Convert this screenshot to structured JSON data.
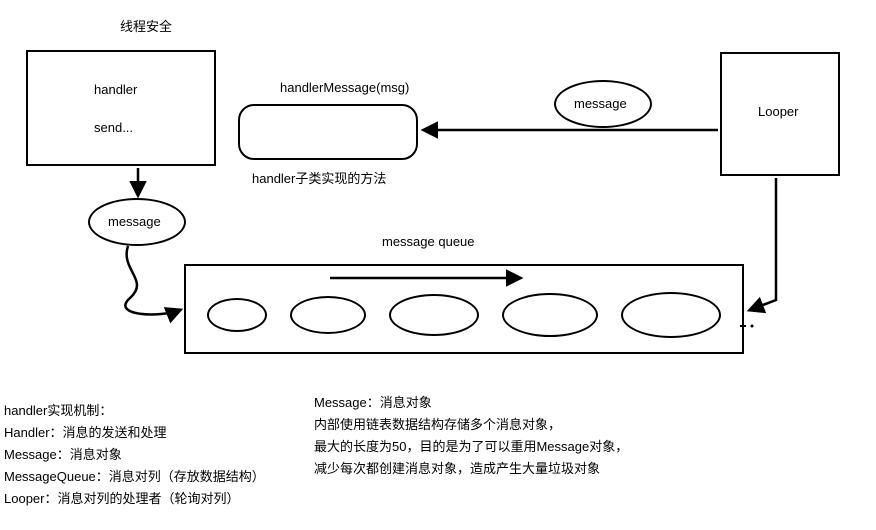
{
  "title": "线程安全",
  "handlerBox": {
    "line1": "handler",
    "line2": "send..."
  },
  "handlerMessage": {
    "top": "handlerMessage(msg)",
    "bottom": "handler子类实现的方法"
  },
  "msgEllipseTop": "message",
  "msgEllipseLeft": "message",
  "looperBox": "Looper",
  "messageQueueLabel": "message queue",
  "leftFooter": {
    "l1": "handler实现机制：",
    "l2": "Handler：消息的发送和处理",
    "l3": "Message：消息对象",
    "l4": "MessageQueue：消息对列（存放数据结构）",
    "l5": "Looper：消息对列的处理者（轮询对列）"
  },
  "rightFooter": {
    "r1": "Message：消息对象",
    "r2": "内部使用链表数据结构存储多个消息对象，",
    "r3": "最大的长度为50，目的是为了可以重用Message对象，",
    "r4": "减少每次都创建消息对象，造成产生大量垃圾对象"
  }
}
